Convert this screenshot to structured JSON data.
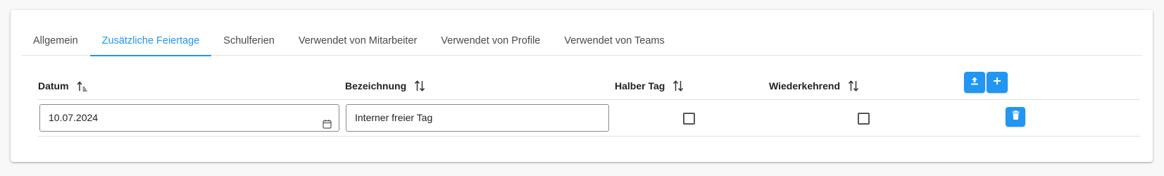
{
  "tabs": [
    {
      "label": "Allgemein"
    },
    {
      "label": "Zusätzliche Feiertage"
    },
    {
      "label": "Schulferien"
    },
    {
      "label": "Verwendet von Mitarbeiter"
    },
    {
      "label": "Verwendet von Profile"
    },
    {
      "label": "Verwendet von Teams"
    }
  ],
  "active_tab": "Zusätzliche Feiertage",
  "columns": {
    "datum": "Datum",
    "bezeichnung": "Bezeichnung",
    "halber_tag": "Halber Tag",
    "wiederkehrend": "Wiederkehrend"
  },
  "rows": [
    {
      "datum": "10.07.2024",
      "bezeichnung": "Interner freier Tag",
      "halber_tag": false,
      "wiederkehrend": false
    }
  ],
  "icons": {
    "sort_active": "sort-ascending-icon",
    "sort": "sort-both-icon",
    "calendar": "calendar-icon",
    "upload": "upload-icon",
    "add": "plus-icon",
    "delete": "trash-icon"
  },
  "colors": {
    "accent": "#2196f3",
    "text": "#222222",
    "tab_text": "#4a4a4a",
    "border": "#e0e0e0"
  }
}
